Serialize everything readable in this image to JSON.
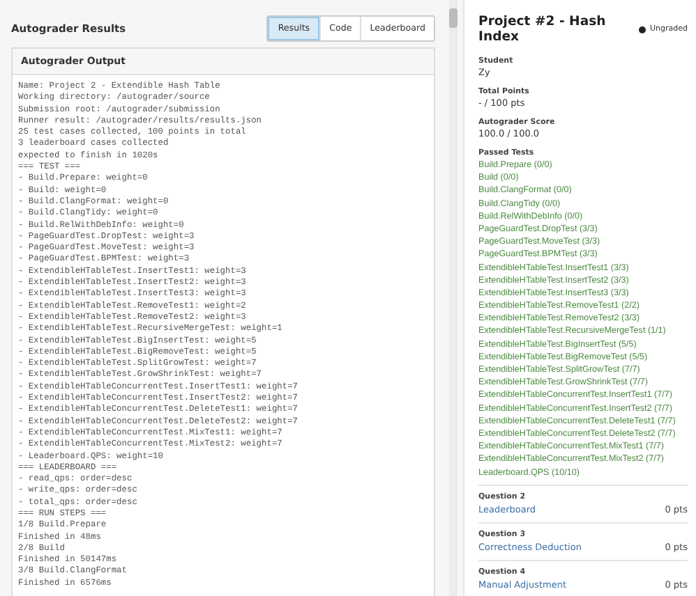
{
  "left": {
    "title": "Autograder Results",
    "tabs": [
      {
        "label": "Results",
        "selected": true
      },
      {
        "label": "Code",
        "selected": false
      },
      {
        "label": "Leaderboard",
        "selected": false
      }
    ],
    "output": {
      "title": "Autograder Output",
      "lines": [
        "Name: Project 2 - Extendible Hash Table",
        "Working directory: /autograder/source",
        "Submission root: /autograder/submission",
        "Runner result: /autograder/results/results.json",
        "25 test cases collected, 100 points in total",
        "3 leaderboard cases collected",
        "expected to finish in 1020s",
        "=== TEST ===",
        "- Build.Prepare: weight=0",
        "- Build: weight=0",
        "- Build.ClangFormat: weight=0",
        "- Build.ClangTidy: weight=0",
        "- Build.RelWithDebInfo: weight=0",
        "- PageGuardTest.DropTest: weight=3",
        "- PageGuardTest.MoveTest: weight=3",
        "- PageGuardTest.BPMTest: weight=3",
        "- ExtendibleHTableTest.InsertTest1: weight=3",
        "- ExtendibleHTableTest.InsertTest2: weight=3",
        "- ExtendibleHTableTest.InsertTest3: weight=3",
        "- ExtendibleHTableTest.RemoveTest1: weight=2",
        "- ExtendibleHTableTest.RemoveTest2: weight=3",
        "- ExtendibleHTableTest.RecursiveMergeTest: weight=1",
        "- ExtendibleHTableTest.BigInsertTest: weight=5",
        "- ExtendibleHTableTest.BigRemoveTest: weight=5",
        "- ExtendibleHTableTest.SplitGrowTest: weight=7",
        "- ExtendibleHTableTest.GrowShrinkTest: weight=7",
        "- ExtendibleHTableConcurrentTest.InsertTest1: weight=7",
        "- ExtendibleHTableConcurrentTest.InsertTest2: weight=7",
        "- ExtendibleHTableConcurrentTest.DeleteTest1: weight=7",
        "- ExtendibleHTableConcurrentTest.DeleteTest2: weight=7",
        "- ExtendibleHTableConcurrentTest.MixTest1: weight=7",
        "- ExtendibleHTableConcurrentTest.MixTest2: weight=7",
        "- Leaderboard.QPS: weight=10",
        "=== LEADERBOARD ===",
        "- read_qps: order=desc",
        "- write_qps: order=desc",
        "- total_qps: order=desc",
        "=== RUN STEPS ===",
        "1/8 Build.Prepare",
        "Finished in 48ms",
        "2/8 Build",
        "Finished in 50147ms",
        "3/8 Build.ClangFormat",
        "Finished in 6576ms"
      ]
    }
  },
  "right": {
    "title": "Project #2 - Hash Index",
    "status": "Ungraded",
    "fields": [
      {
        "label": "Student",
        "value": "Zy"
      },
      {
        "label": "Total Points",
        "value": "- / 100 pts"
      },
      {
        "label": "Autograder Score",
        "value": "100.0 / 100.0"
      }
    ],
    "passed_tests": {
      "label": "Passed Tests",
      "items": [
        "Build.Prepare (0/0)",
        "Build (0/0)",
        "Build.ClangFormat (0/0)",
        "Build.ClangTidy (0/0)",
        "Build.RelWithDebInfo (0/0)",
        "PageGuardTest.DropTest (3/3)",
        "PageGuardTest.MoveTest (3/3)",
        "PageGuardTest.BPMTest (3/3)",
        "ExtendibleHTableTest.InsertTest1 (3/3)",
        "ExtendibleHTableTest.InsertTest2 (3/3)",
        "ExtendibleHTableTest.InsertTest3 (3/3)",
        "ExtendibleHTableTest.RemoveTest1 (2/2)",
        "ExtendibleHTableTest.RemoveTest2 (3/3)",
        "ExtendibleHTableTest.RecursiveMergeTest (1/1)",
        "ExtendibleHTableTest.BigInsertTest (5/5)",
        "ExtendibleHTableTest.BigRemoveTest (5/5)",
        "ExtendibleHTableTest.SplitGrowTest (7/7)",
        "ExtendibleHTableTest.GrowShrinkTest (7/7)",
        "ExtendibleHTableConcurrentTest.InsertTest1 (7/7)",
        "ExtendibleHTableConcurrentTest.InsertTest2 (7/7)",
        "ExtendibleHTableConcurrentTest.DeleteTest1 (7/7)",
        "ExtendibleHTableConcurrentTest.DeleteTest2 (7/7)",
        "ExtendibleHTableConcurrentTest.MixTest1 (7/7)",
        "ExtendibleHTableConcurrentTest.MixTest2 (7/7)",
        "Leaderboard.QPS (10/10)"
      ]
    },
    "questions": [
      {
        "label": "Question 2",
        "name": "Leaderboard",
        "points": "0 pts"
      },
      {
        "label": "Question 3",
        "name": "Correctness Deduction",
        "points": "0 pts"
      },
      {
        "label": "Question 4",
        "name": "Manual Adjustment",
        "points": "0 pts"
      }
    ]
  }
}
